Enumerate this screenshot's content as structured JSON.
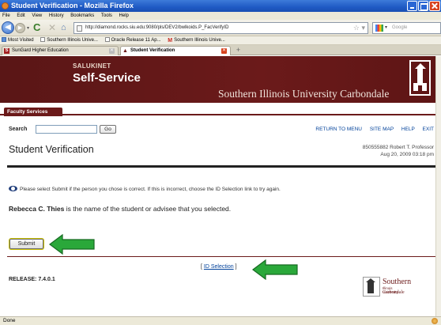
{
  "window": {
    "title": "Student Verification - Mozilla Firefox"
  },
  "menu": [
    "File",
    "Edit",
    "View",
    "History",
    "Bookmarks",
    "Tools",
    "Help"
  ],
  "url": "http://diamond.rocks.siu.edu:9080/pls/DEV2/bwlkoids.P_FacVerifyID",
  "search_placeholder": "Google",
  "bookmarks": [
    "Most Visited",
    "Southern Illinois Unive...",
    "Oracle Release 11 Ap...",
    "Southern Illinois Unive..."
  ],
  "tabs": [
    {
      "label": "SunGard Higher Education"
    },
    {
      "label": "Student Verification"
    }
  ],
  "banner": {
    "salukinet": "SALUKINET",
    "self_service": "Self-Service",
    "university": "Southern Illinois University Carbondale"
  },
  "nav_tab": "Faculty Services",
  "search": {
    "label": "Search",
    "go_label": "Go"
  },
  "toplinks": [
    "RETURN TO MENU",
    "SITE MAP",
    "HELP",
    "EXIT"
  ],
  "page": {
    "title": "Student Verification",
    "user_line": "850555882 Robert T. Professor",
    "date_line": "Aug 20, 2009 03:18 pm",
    "info": "Please select Submit if the person you chose is correct. If this is incorrect, choose the ID Selection link to try again.",
    "student_name": "Rebecca C. Thies",
    "student_suffix": " is the name of the student or advisee that you selected.",
    "submit_label": "Submit",
    "idsel_open": "[ ",
    "idsel_label": "ID Selection",
    "idsel_close": " ]",
    "release": "RELEASE: 7.4.0.1"
  },
  "footer_logo": {
    "word": "Southern",
    "small": "Illinois University",
    "carbondale": "Carbondale"
  },
  "status": "Done",
  "colors": {
    "maroon": "#6b1a1a",
    "arrow_green": "#2aa83a",
    "link_blue": "#00419a"
  }
}
